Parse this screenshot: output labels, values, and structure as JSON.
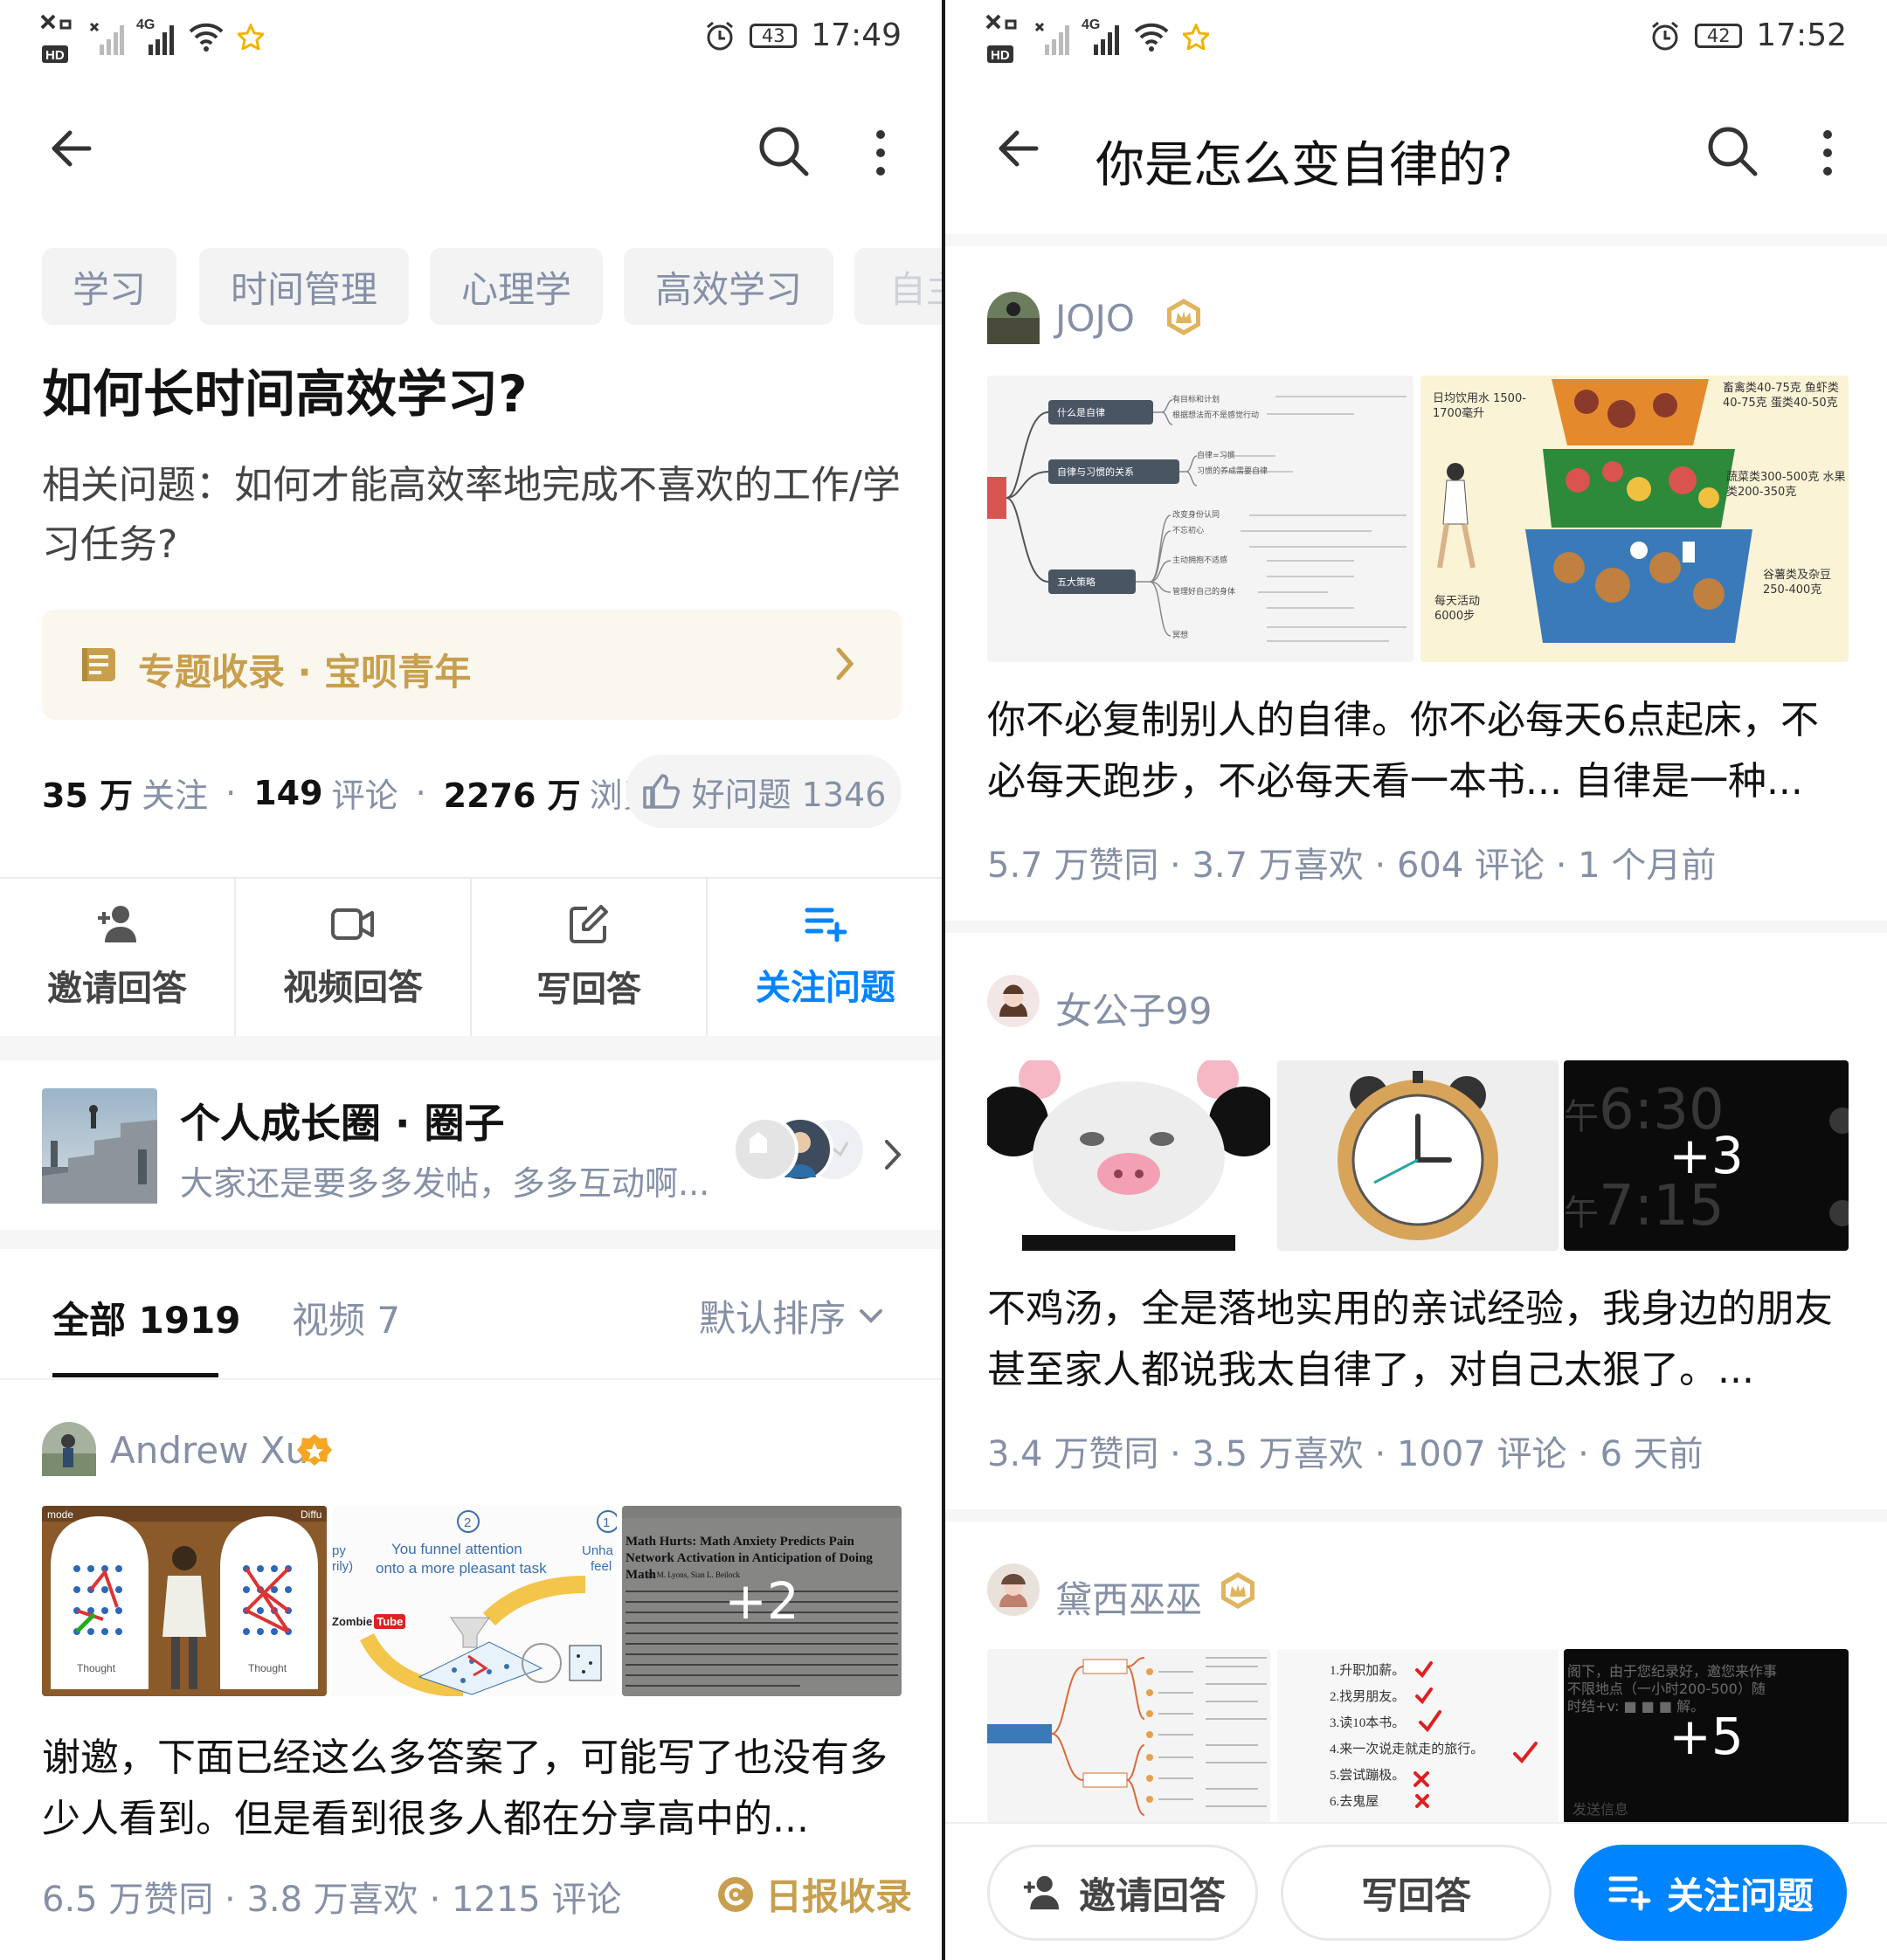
{
  "left": {
    "status": {
      "time": "17:49",
      "battery": "43"
    },
    "topics": [
      "学习",
      "时间管理",
      "心理学",
      "高效学习",
      "自主"
    ],
    "question_title": "如何长时间高效学习?",
    "related_question": "相关问题：如何才能高效率地完成不喜欢的工作/学习任务?",
    "collection": {
      "label": "专题收录 · 宝呗青年"
    },
    "stats": {
      "follow_num": "35 万",
      "follow_label": "关注",
      "comment_num": "149",
      "comment_label": "评论",
      "view_num": "2276 万",
      "view_label": "浏览",
      "good_question": "好问题 1346"
    },
    "actions": [
      {
        "label": "邀请回答",
        "icon": "add-user-icon"
      },
      {
        "label": "视频回答",
        "icon": "video-icon"
      },
      {
        "label": "写回答",
        "icon": "edit-icon"
      },
      {
        "label": "关注问题",
        "icon": "follow-list-icon"
      }
    ],
    "circle": {
      "title": "个人成长圈 · 圈子",
      "desc": "大家还是要多多发帖，多多互动啊..."
    },
    "tabs": {
      "all": "全部 1919",
      "video": "视频 7",
      "sort": "默认排序"
    },
    "answer": {
      "author": "Andrew Xu",
      "img2_line1": "You funnel attention",
      "img2_line2": "onto a more pleasant task",
      "img2_tube": "Zombie",
      "img2_tube2": "Tube",
      "img3_title": "Math Hurts: Math Anxiety Predicts Pain Network Activation in Anticipation of Doing Math",
      "img3_author": "Ian M. Lyons, Sian L. Beilock",
      "more_count": "+2",
      "text": "谢邀，下面已经这么多答案了，可能写了也没有多少人看到。但是看到很多人都在分享高中的...",
      "meta": "6.5 万赞同 · 3.8 万喜欢 · 1215 评论",
      "badge": "日报收录"
    }
  },
  "right": {
    "status": {
      "time": "17:52",
      "battery": "42"
    },
    "title": "你是怎么变自律的?",
    "answers": [
      {
        "author": "JOJO",
        "mindmap_nodes": [
          "什么是自律",
          "自律与习惯的关系",
          "五大策略"
        ],
        "mindmap_leaves": [
          "有目标和计划",
          "根据想法而不是感觉行动",
          "自律=习惯",
          "习惯的养成需要自律",
          "改变身份认同",
          "不忘初心",
          "主动拥抱不适感",
          "管理好自己的身体",
          "冥想"
        ],
        "food_labels": [
          "日均饮用水 1500-1700毫升",
          "畜禽类40-75克 鱼虾类40-75克 蛋类40-50克",
          "蔬菜类300-500克 水果类200-350克",
          "谷薯类及杂豆 250-400克",
          "每天活动 6000步"
        ],
        "text": "你不必复制别人的自律。你不必每天6点起床，不必每天跑步，不必每天看一本书... 自律是一种...",
        "meta": "5.7 万赞同 · 3.7 万喜欢 · 604 评论 · 1 个月前"
      },
      {
        "author": "女公子99",
        "clock_time1": "6:30",
        "clock_time2": "7:15",
        "clock_prefix": "午",
        "more_count": "+3",
        "text": "不鸡汤，全是落地实用的亲试经验，我身边的朋友甚至家人都说我太自律了，对自己太狠了。...",
        "meta": "3.4 万赞同 · 3.5 万喜欢 · 1007 评论 · 6 天前"
      },
      {
        "author": "黛西巫巫",
        "checklist": [
          "1.升职加薪。",
          "2.找男朋友。",
          "3.读10本书。",
          "4.来一次说走就走的旅行。",
          "5.尝试蹦极。",
          "6.去鬼屋"
        ],
        "chat_text": "阁下，由于您纪录好，邀您来作事 不限地点（一小时200-500）随时结+v: ■ ■ ■ 解。",
        "chat_hint": "发送信息",
        "more_count": "+5"
      }
    ],
    "bottom": {
      "invite": "邀请回答",
      "write": "写回答",
      "follow": "关注问题"
    }
  },
  "colors": {
    "blue": "#0084ff",
    "gold": "#c89f4e",
    "gray": "#8590a6",
    "text": "#121212"
  }
}
